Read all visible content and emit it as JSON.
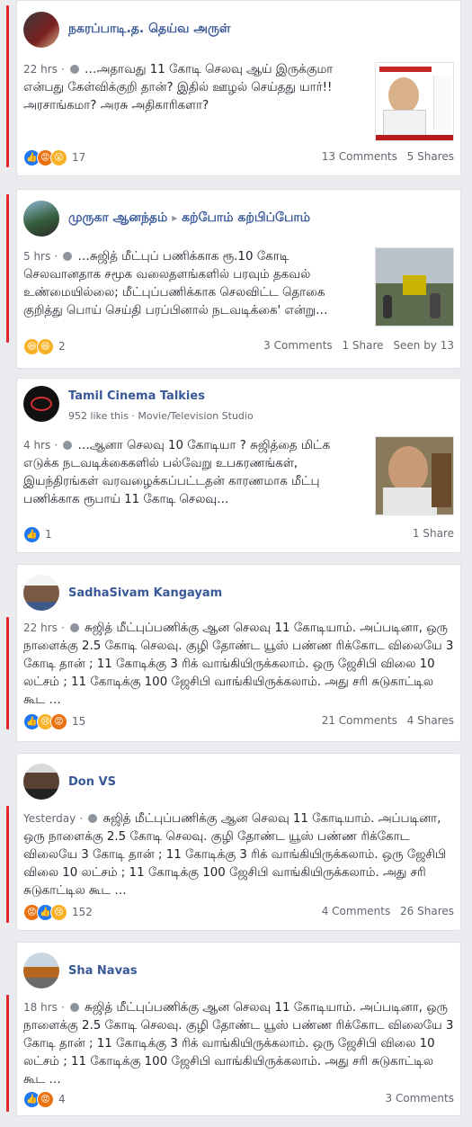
{
  "posts": [
    {
      "author": "நகரப்பாடி.த. தெய்வ அருள்",
      "time": "22 hrs",
      "text": "…அதாவது 11 கோடி செலவு ஆய் இருக்குமா என்பது கேள்விக்குறி தான்? இதில் ஊழல் செய்தது யார்!! அரசாங்கமா? அரசு அதிகாரிகளா?",
      "reactions": [
        "like-icon",
        "angry-icon",
        "wow-icon"
      ],
      "reaction_count": "17",
      "comments": "13 Comments",
      "shares": "5 Shares"
    },
    {
      "author": "முருகா ஆனந்தம்",
      "arrow": "▸",
      "group": "கற்போம் கற்பிப்போம்",
      "time": "5 hrs",
      "text": "…சுஜித் மீட்புப் பணிக்காக ரூ.10 கோடி செலவானதாக சமூக வலைதளங்களில் பரவும் தகவல் உண்மையில்லை; மீட்புப்பணிக்காக செலவிட்ட தொகை குறித்து பொய் செய்தி பரப்பினால் நடவடிக்கை' என்று…",
      "reactions": [
        "haha-icon",
        "haha-icon"
      ],
      "reaction_count": "2",
      "comments": "3 Comments",
      "shares": "1 Share",
      "seen": "Seen by 13"
    },
    {
      "author": "Tamil Cinema Talkies",
      "subline": "952 like this · Movie/Television Studio",
      "time": "4 hrs",
      "text": "…ஆனா செலவு 10 கோடியா ? சுஜித்தை மிட்க எடுக்க நடவடிக்கைகளில் பல்வேறு உபகரணங்கள், இயந்திரங்கள் வரவழைக்கப்பட்டதன் காரணமாக மீட்பு பணிக்காக ரூபாய் 11 கோடி செலவு…",
      "reactions": [
        "like-icon"
      ],
      "reaction_count": "1",
      "shares": "1 Share"
    },
    {
      "author": "SadhaSivam Kangayam",
      "time": "22 hrs",
      "text": "சுஜித் மீட்புப்பணிக்கு ஆன செலவு 11 கோடியாம். அப்படினா, ஒரு நாளைக்கு 2.5 கோடி செலவு. குழி தோண்ட யூஸ் பண்ண ரிக்கோட விலையே 3 கோடி தான் ; 11 கோடிக்கு 3 ரிக் வாங்கியிருக்கலாம். ஒரு ஜேசிபி விலை 10 லட்சம் ; 11 கோடிக்கு 100 ஜேசிபி வாங்கியிருக்கலாம். அது சரி சுடுகாட்டில கூட …",
      "reactions": [
        "like-icon",
        "sad-icon",
        "angry-icon"
      ],
      "reaction_count": "15",
      "comments": "21 Comments",
      "shares": "4 Shares"
    },
    {
      "author": "Don VS",
      "time": "Yesterday",
      "text": "சுஜித் மீட்புப்பணிக்கு ஆன செலவு 11 கோடியாம். அப்படினா, ஒரு நாளைக்கு 2.5 கோடி செலவு. குழி தோண்ட யூஸ் பண்ண ரிக்கோட விலையே 3 கோடி தான் ; 11 கோடிக்கு 3 ரிக் வாங்கியிருக்கலாம். ஒரு ஜேசிபி விலை 10 லட்சம் ; 11 கோடிக்கு 100 ஜேசிபி வாங்கியிருக்கலாம். அது சரி சுடுகாட்டில கூட …",
      "reactions": [
        "angry-icon",
        "like-icon",
        "sad-icon"
      ],
      "reaction_count": "152",
      "comments": "4 Comments",
      "shares": "26 Shares"
    },
    {
      "author": "Sha Navas",
      "time": "18 hrs",
      "text": "சுஜித் மீட்புப்பணிக்கு ஆன செலவு 11 கோடியாம். அப்படினா, ஒரு நாளைக்கு 2.5 கோடி செலவு. குழி தோண்ட யூஸ் பண்ண ரிக்கோட விலையே 3 கோடி தான் ; 11 கோடிக்கு 3 ரிக் வாங்கியிருக்கலாம். ஒரு ஜேசிபி விலை 10 லட்சம் ; 11 கோடிக்கு 100 ஜேசிபி வாங்கியிருக்கலாம். அது சரி சுடுகாட்டில கூட …",
      "reactions": [
        "like-icon",
        "angry-icon"
      ],
      "reaction_count": "4",
      "comments": "3 Comments"
    }
  ],
  "colors": {
    "link": "#385898",
    "accent_bar": "#e3262a",
    "like": "#2078f4",
    "angry": "#e9710f",
    "emoji": "#f7b125"
  }
}
